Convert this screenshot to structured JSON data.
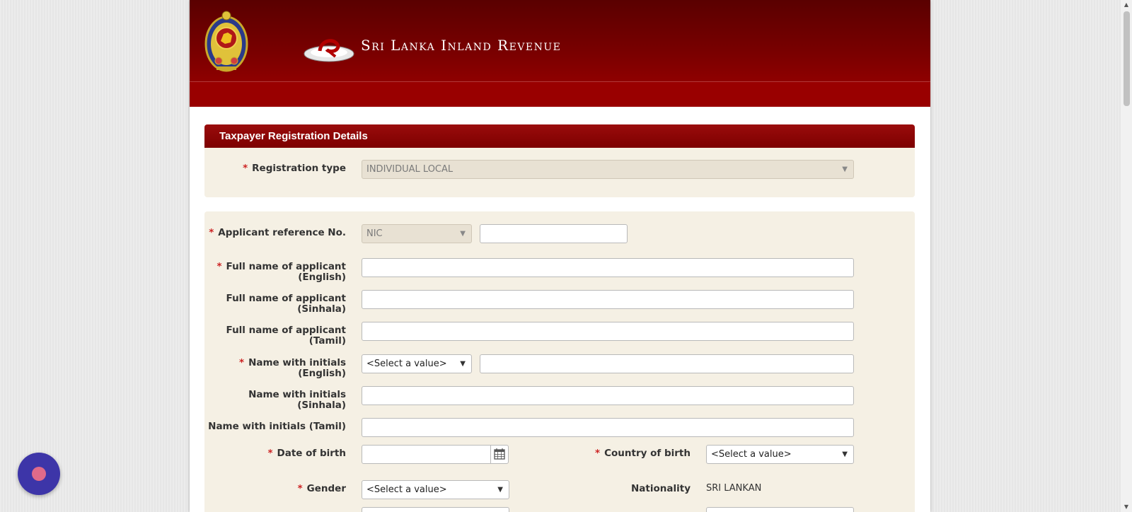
{
  "header": {
    "title": "Sri Lanka Inland Revenue"
  },
  "section": {
    "title": "Taxpayer Registration Details"
  },
  "form": {
    "registration_type": {
      "label": "Registration type",
      "value": "INDIVIDUAL LOCAL"
    },
    "applicant_ref": {
      "label": "Applicant reference No.",
      "type_value": "NIC",
      "value": ""
    },
    "full_name_english": {
      "label_line1": "Full name of applicant",
      "label_line2": "(English)",
      "value": ""
    },
    "full_name_sinhala": {
      "label_line1": "Full name of applicant",
      "label_line2": "(Sinhala)",
      "value": ""
    },
    "full_name_tamil": {
      "label_line1": "Full name of applicant",
      "label_line2": "(Tamil)",
      "value": ""
    },
    "initials_english": {
      "label_line1": "Name with initials",
      "label_line2": "(English)",
      "title_value": "<Select a value>",
      "value": ""
    },
    "initials_sinhala": {
      "label_line1": "Name with initials",
      "label_line2": "(Sinhala)",
      "value": ""
    },
    "initials_tamil": {
      "label": "Name with initials (Tamil)",
      "value": ""
    },
    "date_of_birth": {
      "label": "Date of birth",
      "value": ""
    },
    "country_of_birth": {
      "label": "Country of birth",
      "value": "<Select a value>"
    },
    "gender": {
      "label": "Gender",
      "value": "<Select a value>"
    },
    "nationality": {
      "label": "Nationality",
      "value": "SRI LANKAN"
    }
  },
  "colors": {
    "banner": "#7a0000",
    "section_header": "#8e0808",
    "panel": "#f5f0e4",
    "required": "#cc2222",
    "chat_button": "#3d35a8"
  }
}
